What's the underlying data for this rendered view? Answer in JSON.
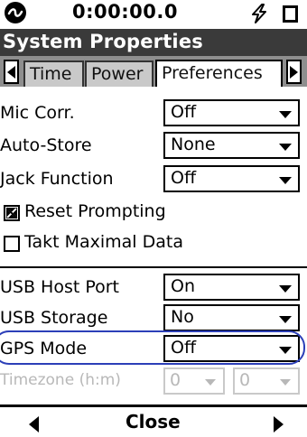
{
  "status": {
    "logo_icon": "circle-logo-icon",
    "timer": "0:00:00.0",
    "power_icon": "lightning-bolt-icon",
    "battery_icon": "battery-icon"
  },
  "window": {
    "title": "System Properties"
  },
  "tabs": {
    "prev_icon": "triangle-left-icon",
    "next_icon": "triangle-right-icon",
    "items": [
      {
        "label": "Time",
        "active": false
      },
      {
        "label": "Power",
        "active": false
      },
      {
        "label": "Preferences",
        "active": true
      }
    ]
  },
  "fields": {
    "mic_corr": {
      "label": "Mic Corr.",
      "value": "Off"
    },
    "auto_store": {
      "label": "Auto-Store",
      "value": "None"
    },
    "jack_function": {
      "label": "Jack Function",
      "value": "Off"
    },
    "usb_host_port": {
      "label": "USB Host Port",
      "value": "On"
    },
    "usb_storage": {
      "label": "USB Storage",
      "value": "No"
    },
    "gps_mode": {
      "label": "GPS Mode",
      "value": "Off"
    },
    "timezone": {
      "label": "Timezone (h:m)",
      "hours": "0",
      "minutes": "0",
      "enabled": false
    }
  },
  "checkboxes": {
    "reset_prompting": {
      "label": "Reset Prompting",
      "checked": true
    },
    "takt_maximal": {
      "label": "Takt Maximal Data",
      "checked": false
    }
  },
  "footer": {
    "prev_icon": "triangle-left-icon",
    "close_label": "Close",
    "next_icon": "triangle-right-icon"
  },
  "colors": {
    "title_bar": "#3a3a3a",
    "tab_strip": "#8e8e8e",
    "inactive_tab": "#c9c9c9",
    "highlight": "#2c3fb8",
    "disabled_text": "#b8b8b8"
  }
}
